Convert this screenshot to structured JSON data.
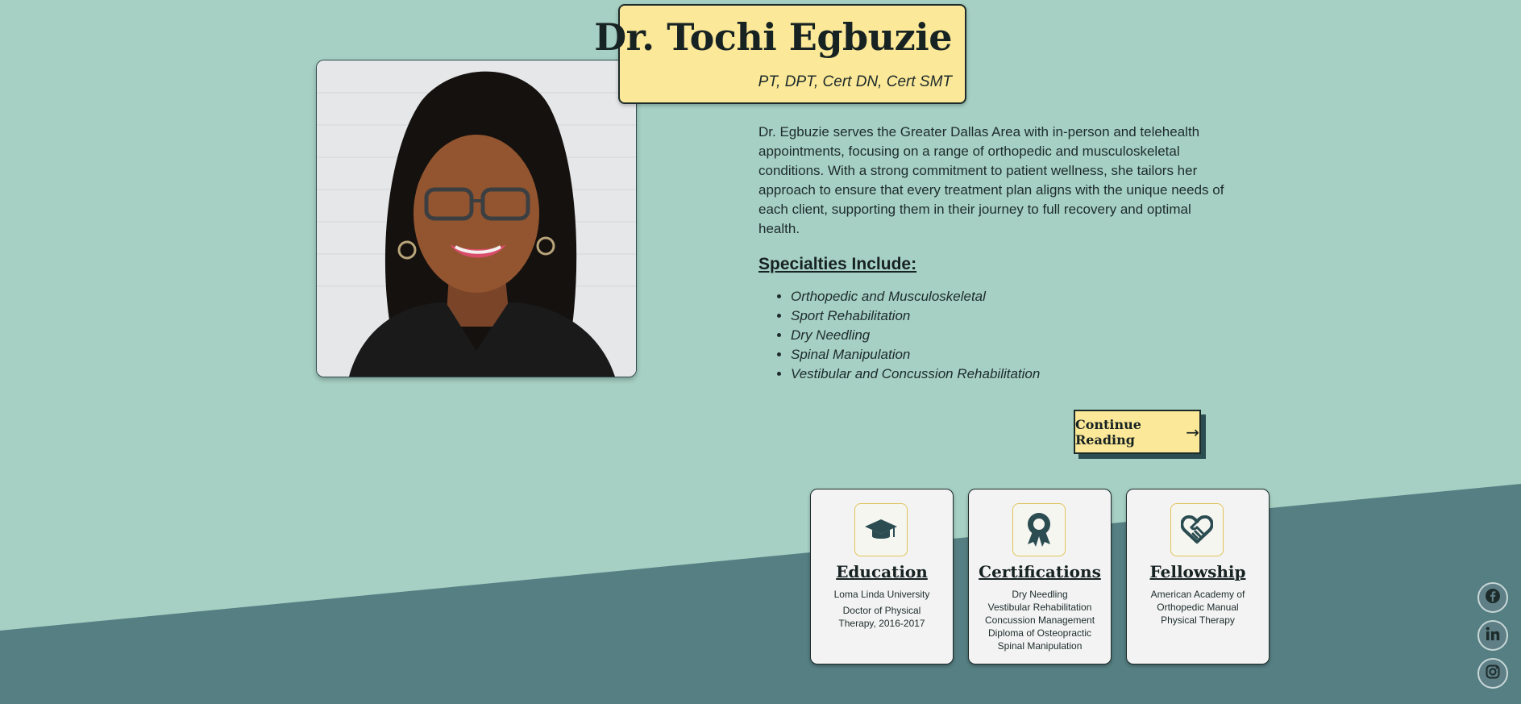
{
  "colors": {
    "background": "#a6d0c3",
    "band": "#557f83",
    "accent_yellow": "#fbe898",
    "icon_color": "#2b4d52"
  },
  "header": {
    "name": "Dr. Tochi Egbuzie",
    "credentials": "PT, DPT, Cert DN, Cert SMT"
  },
  "bio": "Dr. Egbuzie serves the Greater Dallas Area with in-person and telehealth appointments, focusing on a range of orthopedic and musculoskeletal conditions. With a strong commitment to patient wellness, she tailors her approach to ensure that every treatment plan aligns with the unique needs of each client, supporting them in their journey to full recovery and optimal health.",
  "specialties": {
    "heading": "Specialties Include:",
    "items": [
      "Orthopedic and Musculoskeletal",
      "Sport Rehabilitation",
      "Dry Needling",
      "Spinal Manipulation",
      "Vestibular and Concussion Rehabilitation"
    ]
  },
  "cta": {
    "label": "Continue Reading",
    "icon": "arrow-right-icon"
  },
  "cards": [
    {
      "title": "Education",
      "icon": "graduation-cap-icon",
      "lines": [
        "Loma Linda University",
        "Doctor of Physical",
        "Therapy, 2016-2017"
      ]
    },
    {
      "title": "Certifications",
      "icon": "award-ribbon-icon",
      "lines": [
        "Dry Needling",
        "Vestibular Rehabilitation",
        "Concussion Management",
        "Diploma of Osteopractic",
        "Spinal Manipulation"
      ]
    },
    {
      "title": "Fellowship",
      "icon": "heart-handshake-icon",
      "lines": [
        "American Academy of",
        "Orthopedic Manual",
        "Physical Therapy"
      ]
    }
  ],
  "social": [
    {
      "icon": "facebook-icon"
    },
    {
      "icon": "linkedin-icon"
    },
    {
      "icon": "instagram-icon"
    }
  ]
}
